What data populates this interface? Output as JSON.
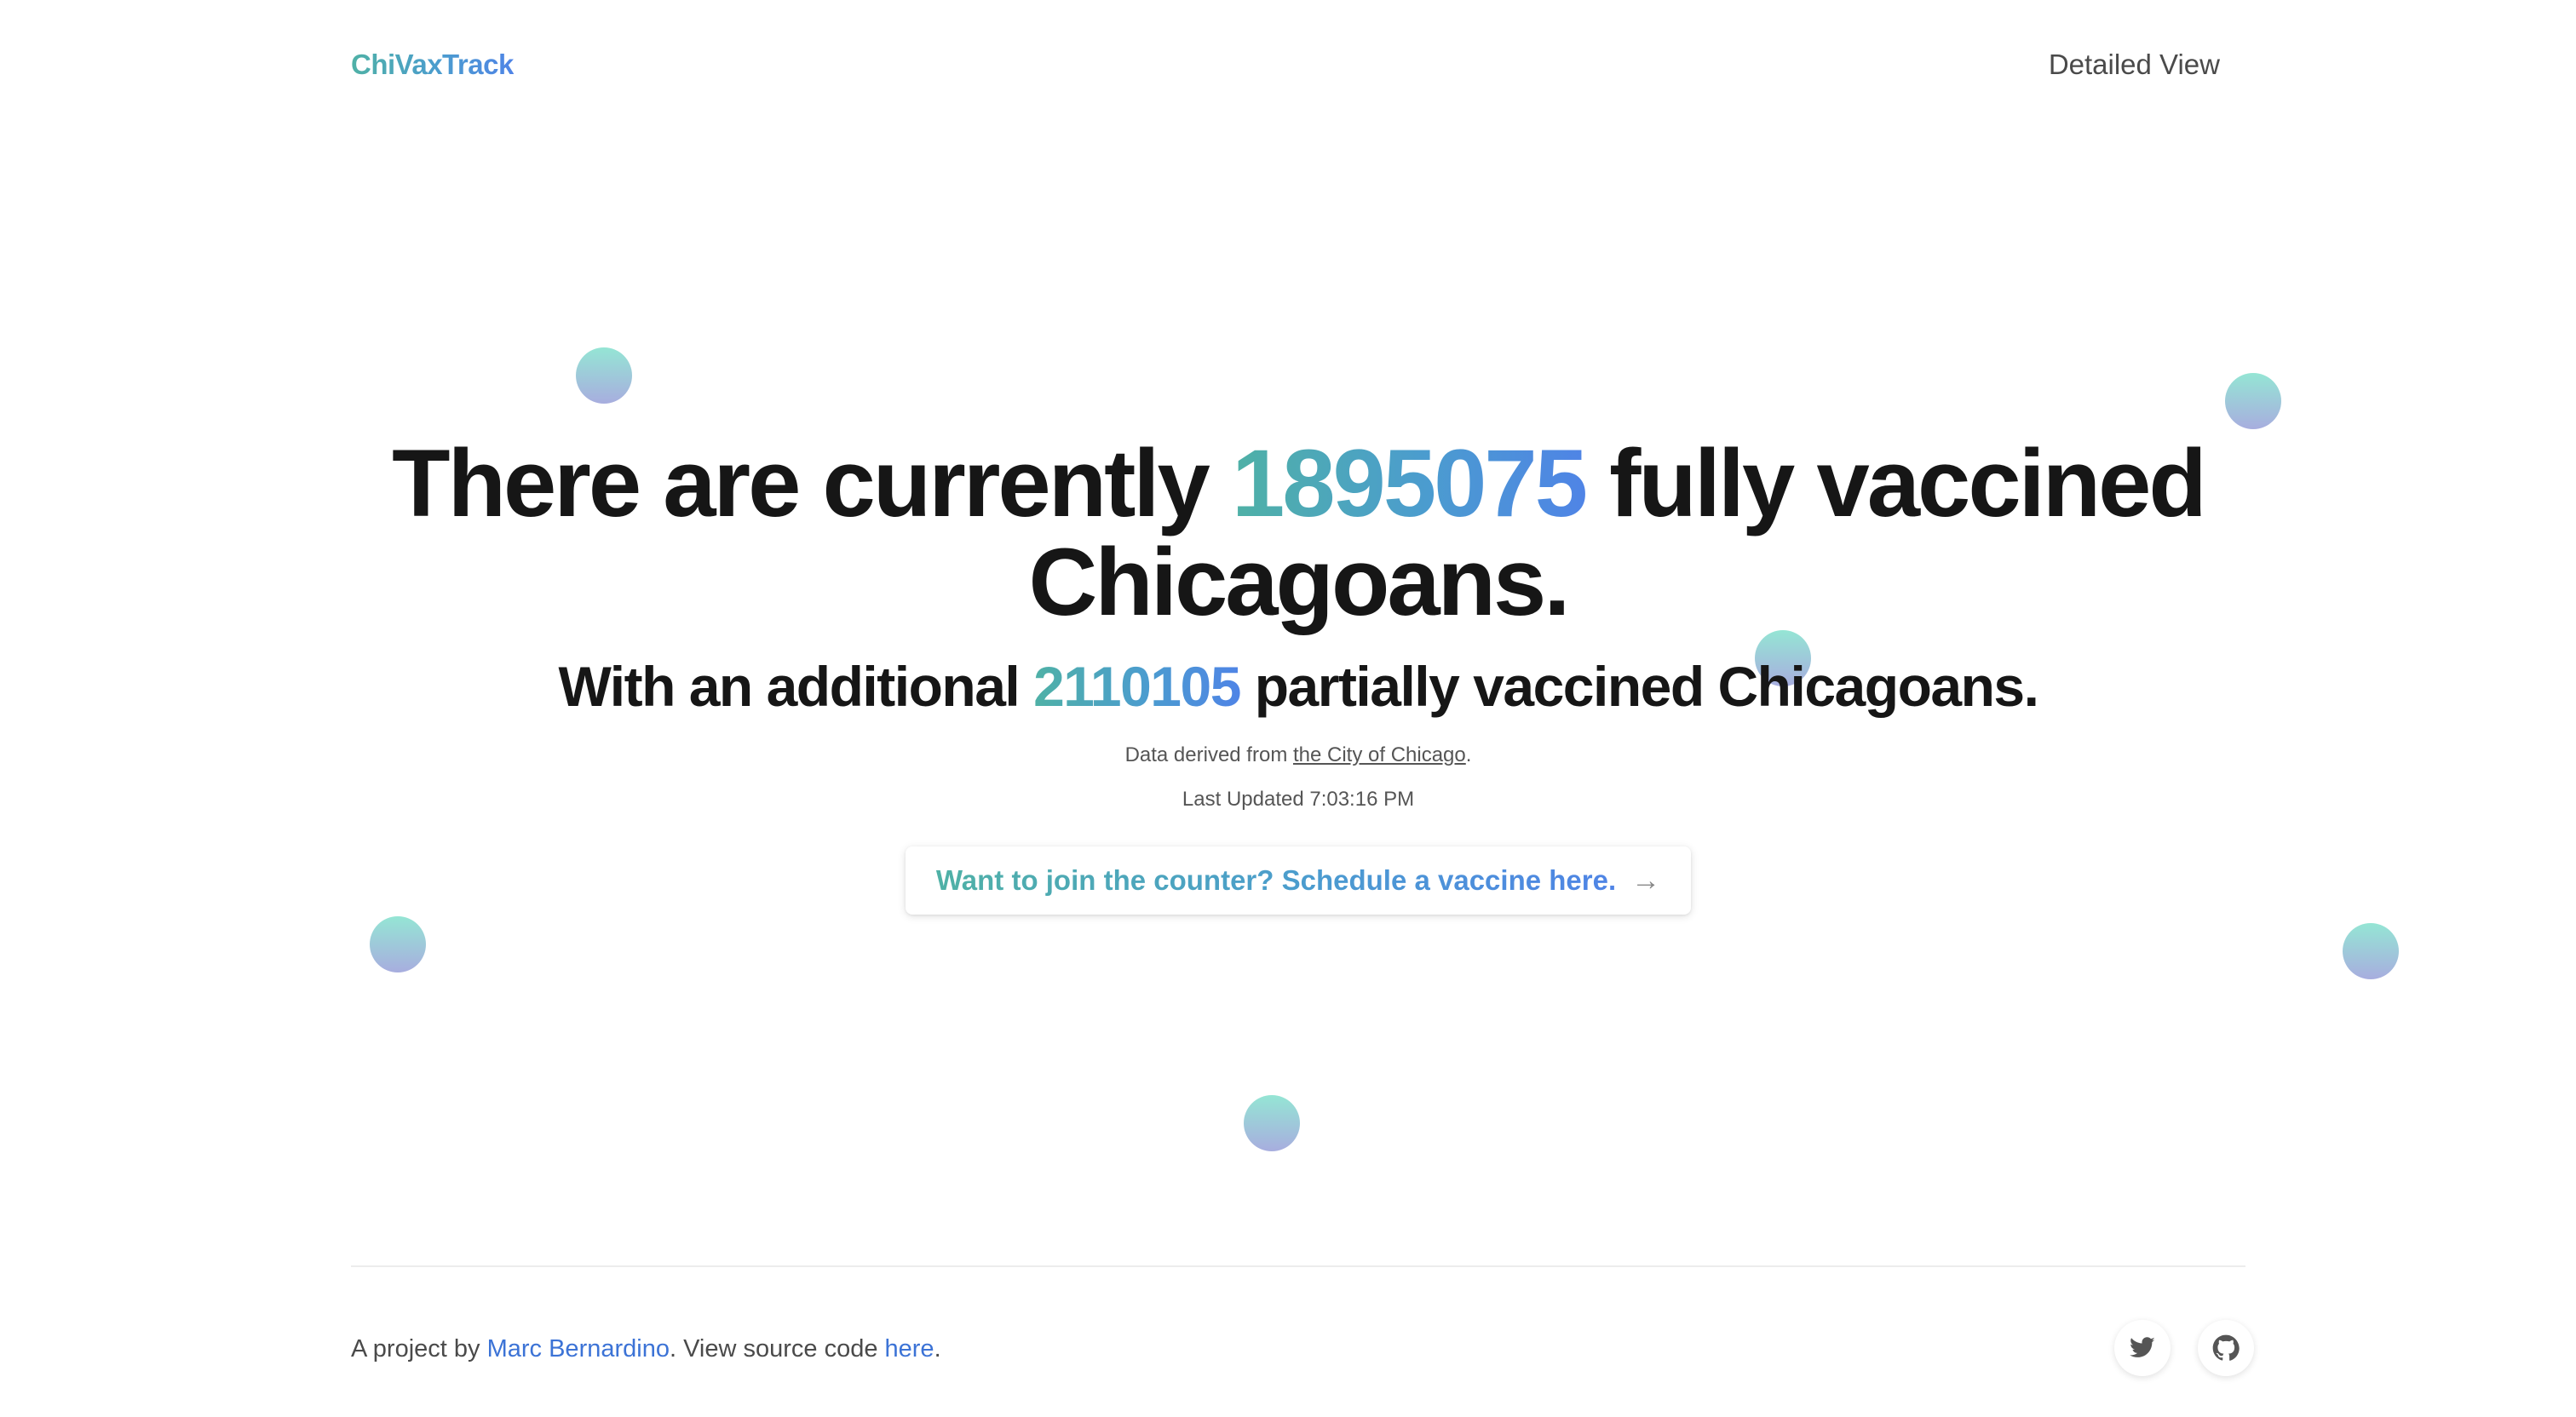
{
  "header": {
    "logo": "ChiVaxTrack",
    "nav_link": "Detailed View"
  },
  "hero": {
    "headline_prefix": "There are currently ",
    "fully_vaccinated_count": "1895075",
    "headline_suffix": " fully vaccined Chicagoans.",
    "subline_prefix": "With an additional ",
    "partially_vaccinated_count": "2110105",
    "subline_suffix": " partially vaccined Chicagoans.",
    "source_prefix": "Data derived from ",
    "source_link": "the City of Chicago",
    "source_suffix": ".",
    "last_updated": "Last Updated 7:03:16 PM",
    "cta_label": "Want to join the counter? Schedule a vaccine here.",
    "cta_icon": "arrow-right-icon"
  },
  "footer": {
    "prefix": "A project by ",
    "author": "Marc Bernardino",
    "middle": ". View source code ",
    "source_link": "here",
    "suffix": ".",
    "social": [
      {
        "icon": "twitter-icon"
      },
      {
        "icon": "github-icon"
      }
    ]
  },
  "colors": {
    "gradient_start": "#4fb1a6",
    "gradient_end": "#4f84e6",
    "footer_link": "#3c73d6",
    "dot_top": "#8fe4d2",
    "dot_bottom": "#a3a9dd"
  }
}
